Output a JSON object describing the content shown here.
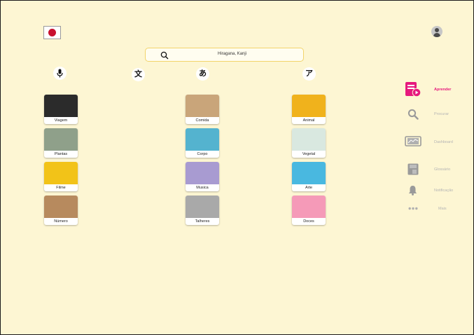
{
  "header": {
    "flag_icon": "japan-flag-icon",
    "profile_icon": "user-icon"
  },
  "search": {
    "value": "Hiragana, Kanji",
    "icon": "search-icon"
  },
  "modes": [
    {
      "icon": "microphone-icon",
      "glyph": ""
    },
    {
      "icon": "kanji-icon",
      "glyph": "文"
    },
    {
      "icon": "hiragana-icon",
      "glyph": "あ"
    },
    {
      "icon": "katakana-icon",
      "glyph": "ア"
    }
  ],
  "categories": [
    {
      "label": "Viagem",
      "color": "#2b2b2b"
    },
    {
      "label": "Plantas",
      "color": "#8fa08a"
    },
    {
      "label": "Filme",
      "color": "#f2c318"
    },
    {
      "label": "Número",
      "color": "#b78a5e"
    },
    {
      "label": "Comida",
      "color": "#c9a57a"
    },
    {
      "label": "Corpo",
      "color": "#54b3cf"
    },
    {
      "label": "Musica",
      "color": "#a89bd1"
    },
    {
      "label": "Talheres",
      "color": "#a9a9a9"
    },
    {
      "label": "Animal",
      "color": "#f0b21c"
    },
    {
      "label": "Vegetal",
      "color": "#d9e8e0"
    },
    {
      "label": "Arte",
      "color": "#49b8e0"
    },
    {
      "label": "Doces",
      "color": "#f59ab8"
    }
  ],
  "nav": {
    "active_color": "#e6197d",
    "items": [
      {
        "label": "Aprender",
        "icon": "book-play-icon",
        "active": true
      },
      {
        "label": "Procurar",
        "icon": "search-icon",
        "active": false
      },
      {
        "label": "Dashboard",
        "icon": "chart-monitor-icon",
        "active": false
      },
      {
        "label": "Glossário",
        "icon": "glossary-icon",
        "active": false
      },
      {
        "label": "Notificação",
        "icon": "bell-icon",
        "active": false
      },
      {
        "label": "Mais",
        "icon": "more-icon",
        "active": false
      }
    ]
  }
}
